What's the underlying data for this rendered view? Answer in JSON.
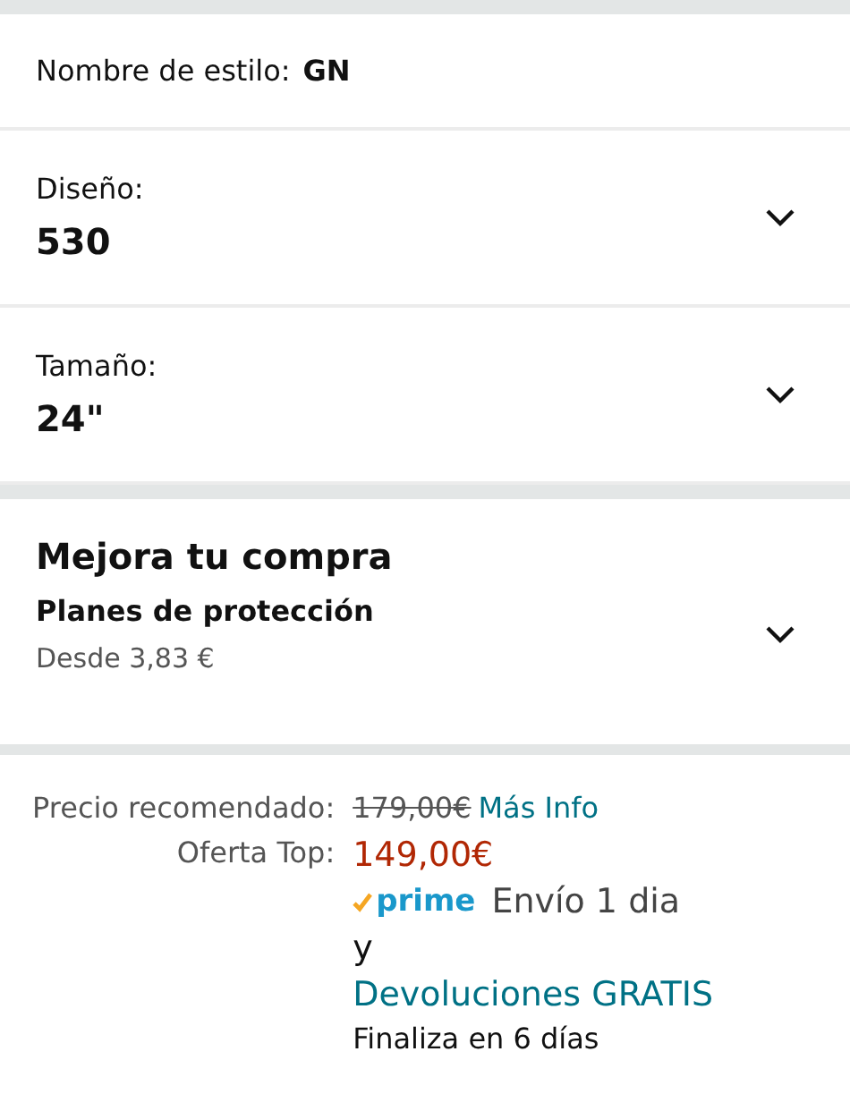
{
  "style_name": {
    "label": "Nombre de estilo:",
    "value": "GN"
  },
  "selectors": [
    {
      "label": "Diseño:",
      "value": "530",
      "expanded": false
    },
    {
      "label": "Tamaño:",
      "value": "24\"",
      "expanded": false
    }
  ],
  "upgrade": {
    "title": "Mejora tu compra",
    "plan": {
      "name": "Planes de protección",
      "price": "Desde 3,83 €",
      "expanded": false
    }
  },
  "pricing": {
    "list_label": "Precio recomendado:",
    "list_price": "179,00€",
    "more_info": "Más Info",
    "deal_label": "Oferta Top:",
    "deal_price": "149,00€",
    "prime": "prime",
    "delivery": "Envío 1 dia",
    "conjunction": "y",
    "returns": "Devoluciones GRATIS",
    "ends": "Finaliza en 6 días"
  }
}
